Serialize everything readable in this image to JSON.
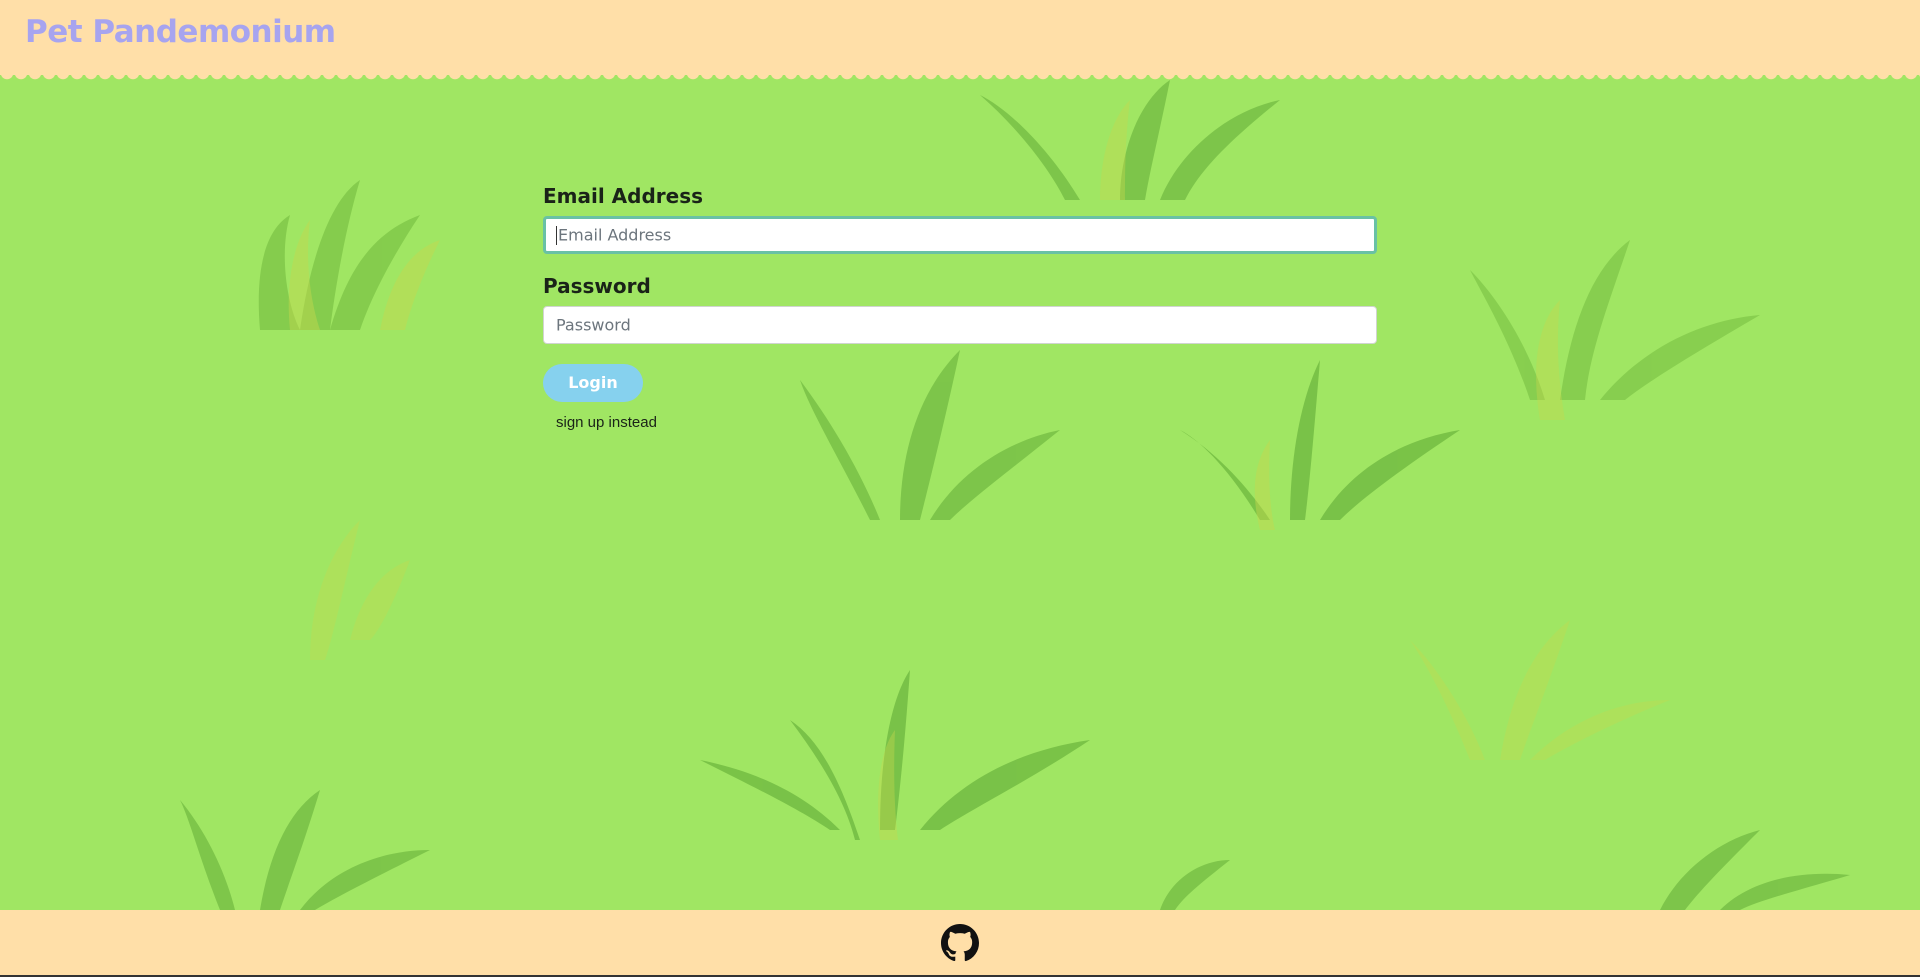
{
  "header": {
    "brand": "Pet Pandemonium"
  },
  "login_form": {
    "email_label": "Email Address",
    "email_placeholder": "Email Address",
    "password_label": "Password",
    "password_placeholder": "Password",
    "login_button": "Login",
    "signup_link": "sign up instead"
  },
  "footer": {
    "icon": "github-icon"
  },
  "colors": {
    "background": "#a0e663",
    "header": "#ffdfa8",
    "brand": "#a7a4ef",
    "button": "#86d1ee",
    "focus_border": "#69c1a5"
  }
}
